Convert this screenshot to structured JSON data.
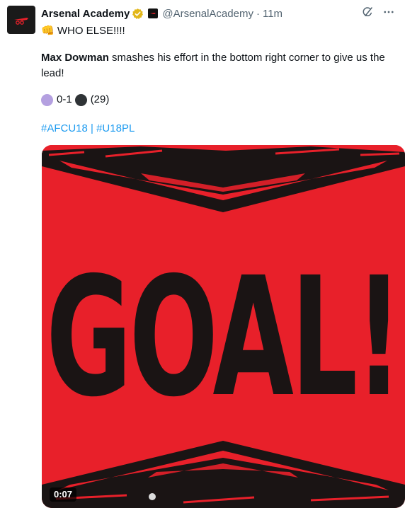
{
  "tweet": {
    "author_name": "Arsenal Academy",
    "handle": "@ArsenalAcademy",
    "separator": "·",
    "time": "11m",
    "line1_emoji": "👊",
    "line1_text": "WHO ELSE!!!!",
    "line2_bold": "Max Dowman",
    "line2_text": " smashes his effort in the bottom right corner to give us the lead!",
    "score_text": "0-1",
    "score_minute": "(29)",
    "hashtag1": "#AFCU18",
    "hashtag_sep": " | ",
    "hashtag2": "#U18PL"
  },
  "media": {
    "goal_text": "GOAL!",
    "duration": "0:07"
  },
  "icons": {
    "verified": "gold-verified-badge-icon",
    "affiliate": "arsenal-affiliate-badge-icon",
    "grok": "grok-icon",
    "more": "more-icon",
    "cannon": "arsenal-cannon-logo-icon",
    "score_home": "lilac-circle-icon",
    "score_away": "black-circle-icon"
  },
  "colors": {
    "accent_blue": "#1d9bf0",
    "secondary_text": "#536471",
    "verified_gold": "#e2b719",
    "media_red": "#e8202a",
    "score_home_color": "#b4a0e0",
    "score_away_color": "#333333"
  }
}
